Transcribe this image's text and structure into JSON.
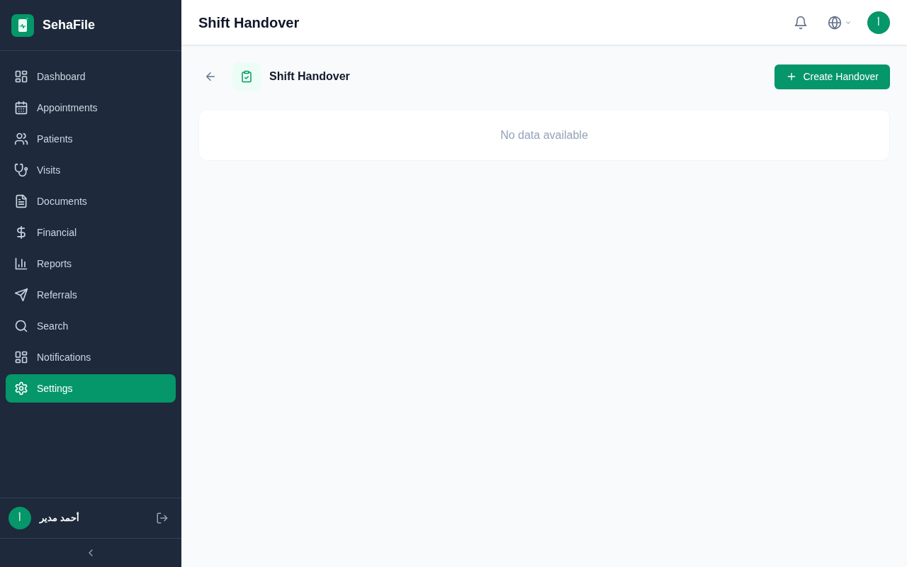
{
  "sidebar": {
    "brand": "SehaFile",
    "items": [
      {
        "label": "Dashboard",
        "selected": false
      },
      {
        "label": "Appointments",
        "selected": false
      },
      {
        "label": "Patients",
        "selected": false
      },
      {
        "label": "Visits",
        "selected": false
      },
      {
        "label": "Documents",
        "selected": false
      },
      {
        "label": "Financial",
        "selected": false
      },
      {
        "label": "Reports",
        "selected": false
      },
      {
        "label": "Referrals",
        "selected": false
      },
      {
        "label": "Search",
        "selected": false
      },
      {
        "label": "Notifications",
        "selected": false
      },
      {
        "label": "Settings",
        "selected": true
      }
    ],
    "user": {
      "initial": "أ",
      "name": "أحمد مدير"
    }
  },
  "header": {
    "title": "Shift Handover",
    "avatar_initial": "أ"
  },
  "page": {
    "title": "Shift Handover",
    "create_button": "Create Handover",
    "empty_message": "No data available"
  }
}
